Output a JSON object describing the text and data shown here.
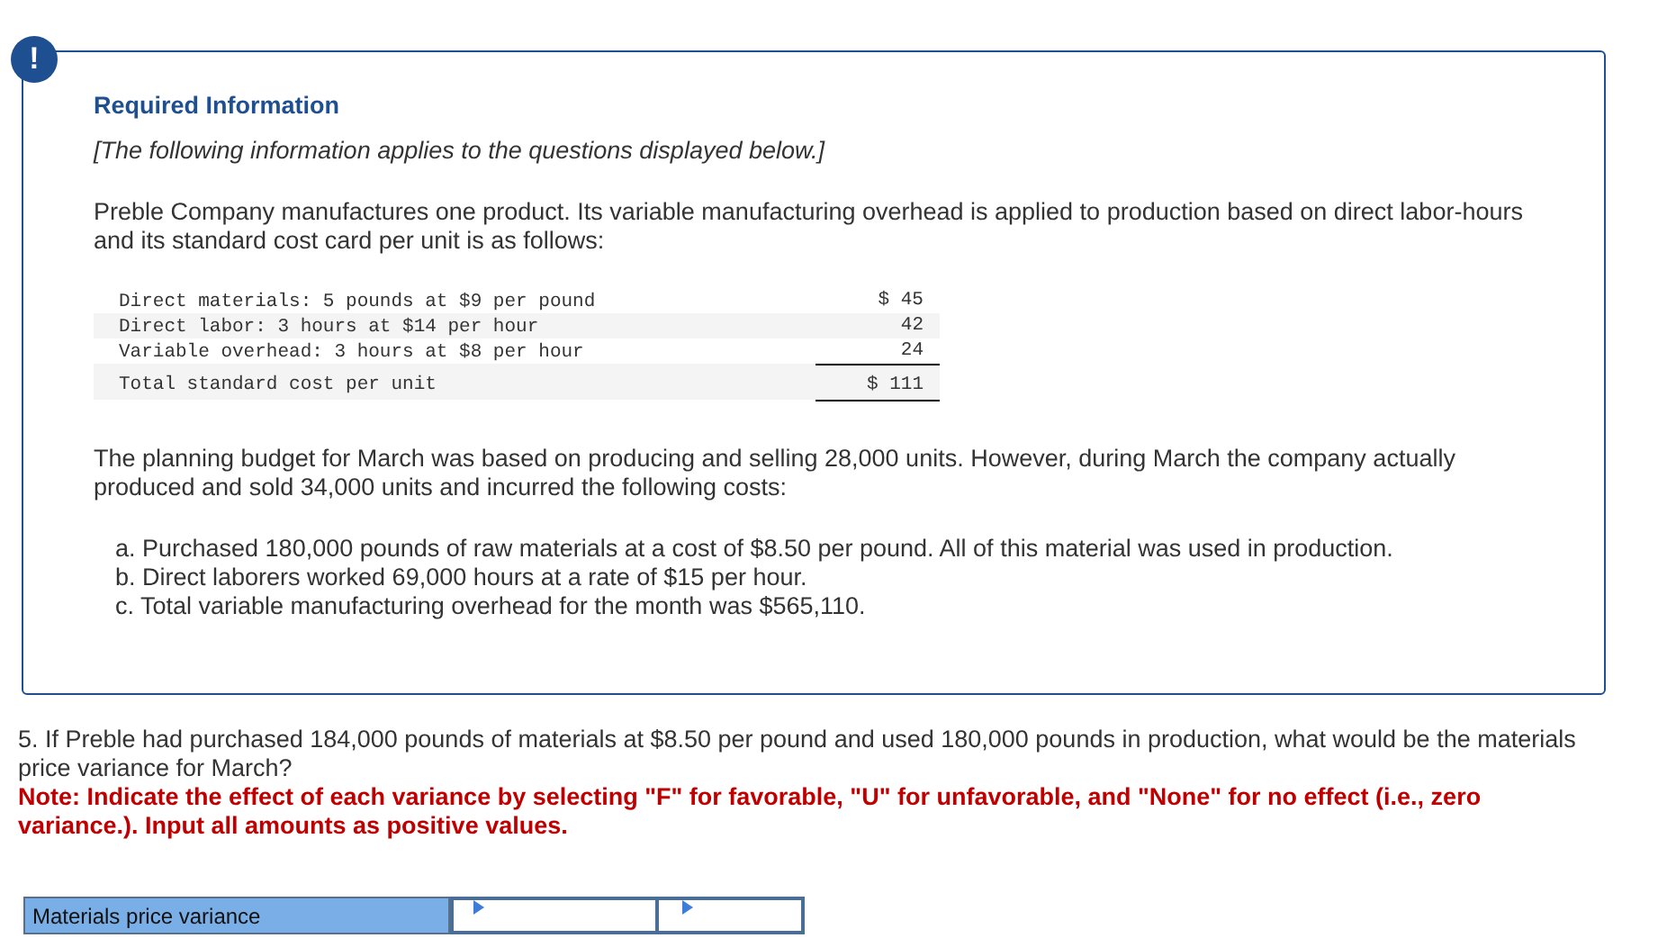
{
  "alert": {
    "icon": "!"
  },
  "info": {
    "heading": "Required Information",
    "note": "[The following information applies to the questions displayed below.]",
    "intro": "Preble Company manufactures one product. Its variable manufacturing overhead is applied to production based on direct labor-hours and its standard cost card per unit is as follows:",
    "cost_card": [
      {
        "kind": "item",
        "label": "Direct materials: 5 pounds at $9 per pound",
        "amount": "$ 45"
      },
      {
        "kind": "item",
        "label": "Direct labor: 3 hours at $14 per hour",
        "amount": "42"
      },
      {
        "kind": "item",
        "label": "Variable overhead: 3 hours at $8 per hour",
        "amount": "24"
      },
      {
        "kind": "total",
        "label": "Total standard cost per unit",
        "amount": "$ 111"
      }
    ],
    "budget_text": "The planning budget for March was based on producing and selling 28,000 units. However, during March the company actually produced and sold 34,000 units and incurred the following costs:",
    "costs": [
      "a. Purchased 180,000 pounds of raw materials at a cost of $8.50 per pound. All of this material was used in production.",
      "b. Direct laborers worked 69,000 hours at a rate of $15 per hour.",
      "c. Total variable manufacturing overhead for the month was $565,110."
    ]
  },
  "question": {
    "text": "5. If Preble had purchased 184,000 pounds of materials at $8.50 per pound and used 180,000 pounds in production, what would be the materials price variance for March?",
    "note": "Note: Indicate the effect of each variance by selecting \"F\" for favorable, \"U\" for unfavorable, and \"None\" for no effect (i.e., zero variance.). Input all amounts as positive values."
  },
  "answer_row": {
    "label": "Materials price variance"
  }
}
